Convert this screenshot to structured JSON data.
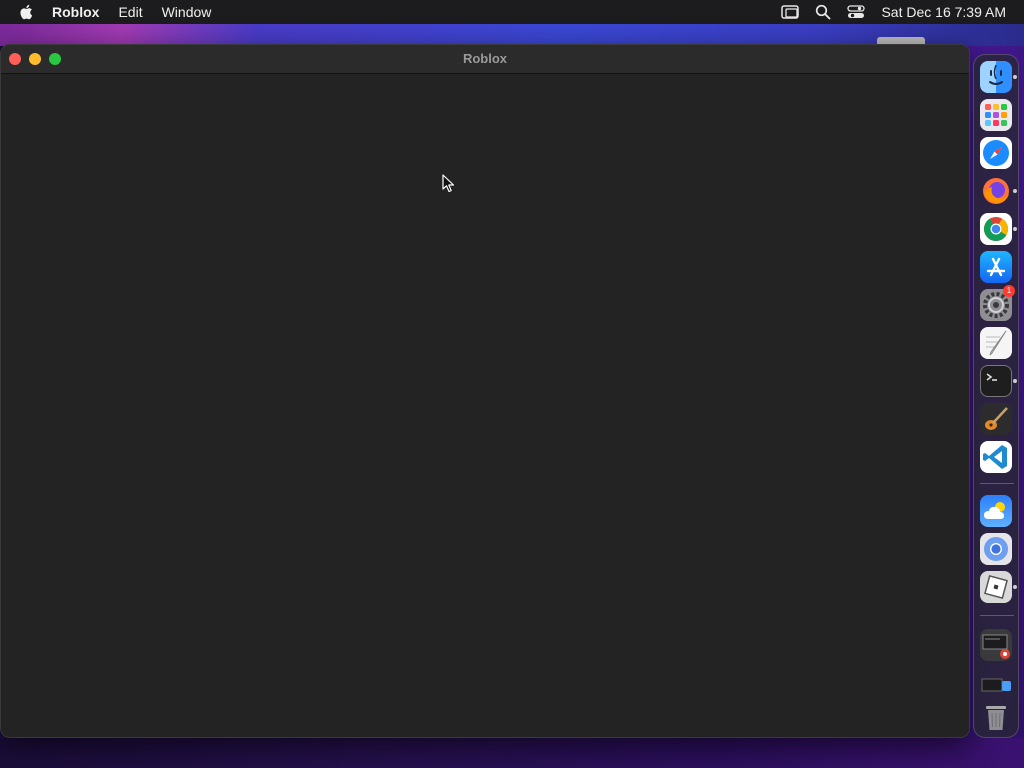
{
  "menubar": {
    "app_name": "Roblox",
    "items": [
      "Edit",
      "Window"
    ],
    "clock": "Sat Dec 16  7:39 AM"
  },
  "window": {
    "title": "Roblox"
  },
  "dock": {
    "apps": [
      "Finder",
      "Launchpad",
      "Safari",
      "Firefox",
      "Google Chrome",
      "App Store",
      "System Settings",
      "TextEdit",
      "Terminal",
      "GarageBand",
      "Visual Studio Code",
      "Weather",
      "Chromium",
      "Roblox",
      "Downloads",
      "Stack",
      "Trash"
    ],
    "badge_count": "1"
  },
  "colors": {
    "close": "#ff5f57",
    "minimize": "#febc2e",
    "maximize": "#28c840"
  }
}
